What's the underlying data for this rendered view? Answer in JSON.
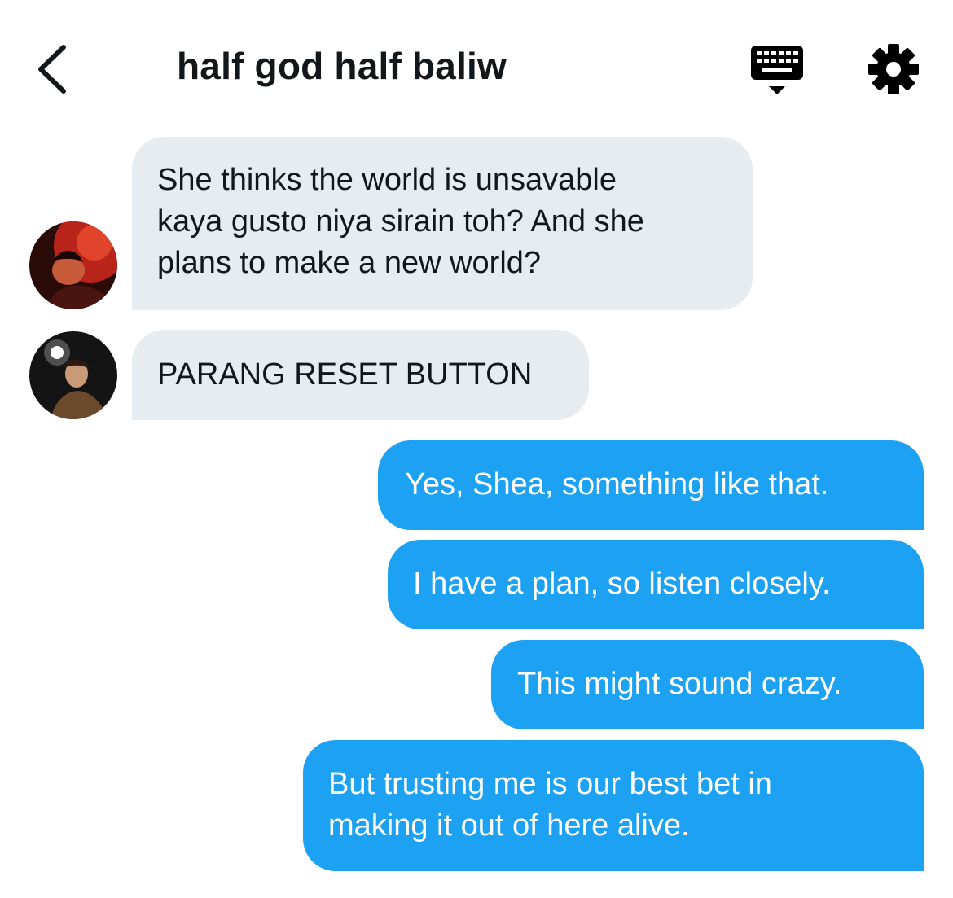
{
  "header": {
    "title": "half god half baliw",
    "back_icon": "chevron-left-icon",
    "keyboard_icon": "keyboard-icon",
    "settings_icon": "gear-icon"
  },
  "colors": {
    "outgoing_bubble": "#1da1f2",
    "incoming_bubble": "#e6ecf0",
    "text_dark": "#14171a"
  },
  "messages": [
    {
      "direction": "incoming",
      "text": "She thinks the world is unsavable\nkaya gusto niya sirain toh? And she\nplans to make a new world?"
    },
    {
      "direction": "incoming",
      "text": "PARANG RESET BUTTON"
    },
    {
      "direction": "outgoing",
      "text": "Yes, Shea, something like that."
    },
    {
      "direction": "outgoing",
      "text": "I have a plan, so listen closely."
    },
    {
      "direction": "outgoing",
      "text": "This might sound crazy."
    },
    {
      "direction": "outgoing",
      "text": "But trusting me is our best bet in\nmaking it out of here alive."
    }
  ]
}
